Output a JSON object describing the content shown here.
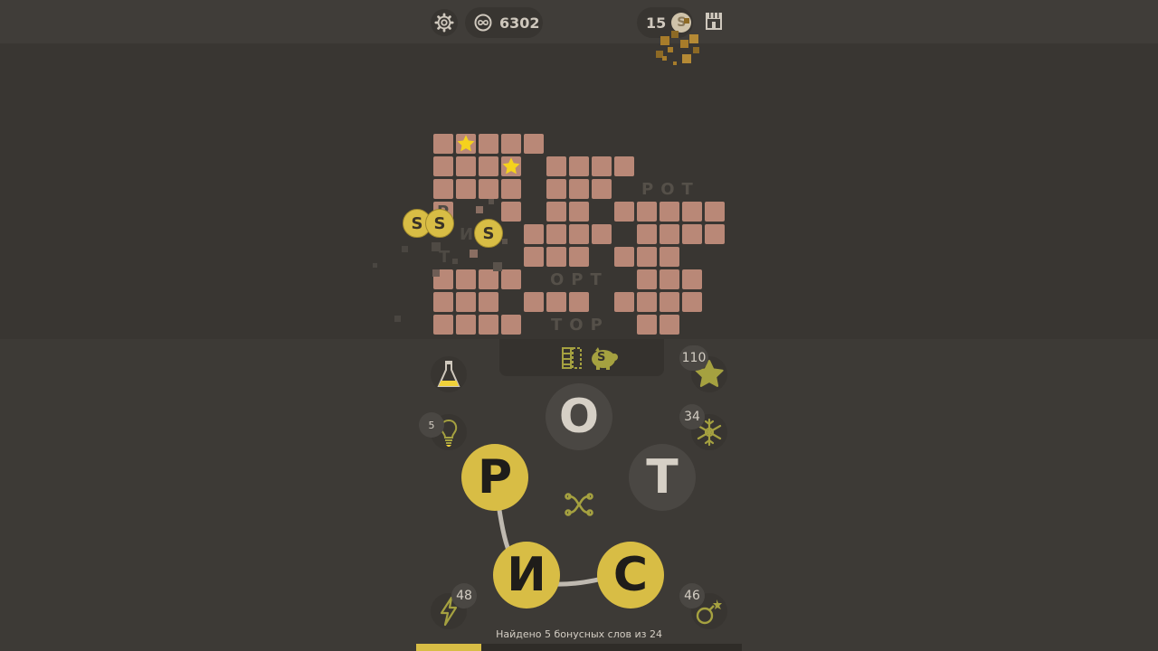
{
  "topbar": {
    "coins": "6302",
    "gold": "15",
    "gold_symbol": "S"
  },
  "board": {
    "words": [
      "POT",
      "OPT",
      "TOP"
    ],
    "ghost_letters": [
      "P",
      "И",
      "Т"
    ],
    "coin_symbol": "S"
  },
  "tabs": {
    "piggy_symbol": "S"
  },
  "boosters": {
    "star_count": "110",
    "hint_count": "5",
    "snowflake_count": "34",
    "lightning_count": "48",
    "bomb_count": "46"
  },
  "wheel": {
    "letters": [
      "O",
      "T",
      "P",
      "И",
      "C"
    ]
  },
  "footer": {
    "found_text": "Найдено 5 бонусных слов из 24",
    "progress": 0.2
  },
  "colors": {
    "accent": "#d8bd45",
    "tile": "#b98877",
    "background": "#373430"
  }
}
